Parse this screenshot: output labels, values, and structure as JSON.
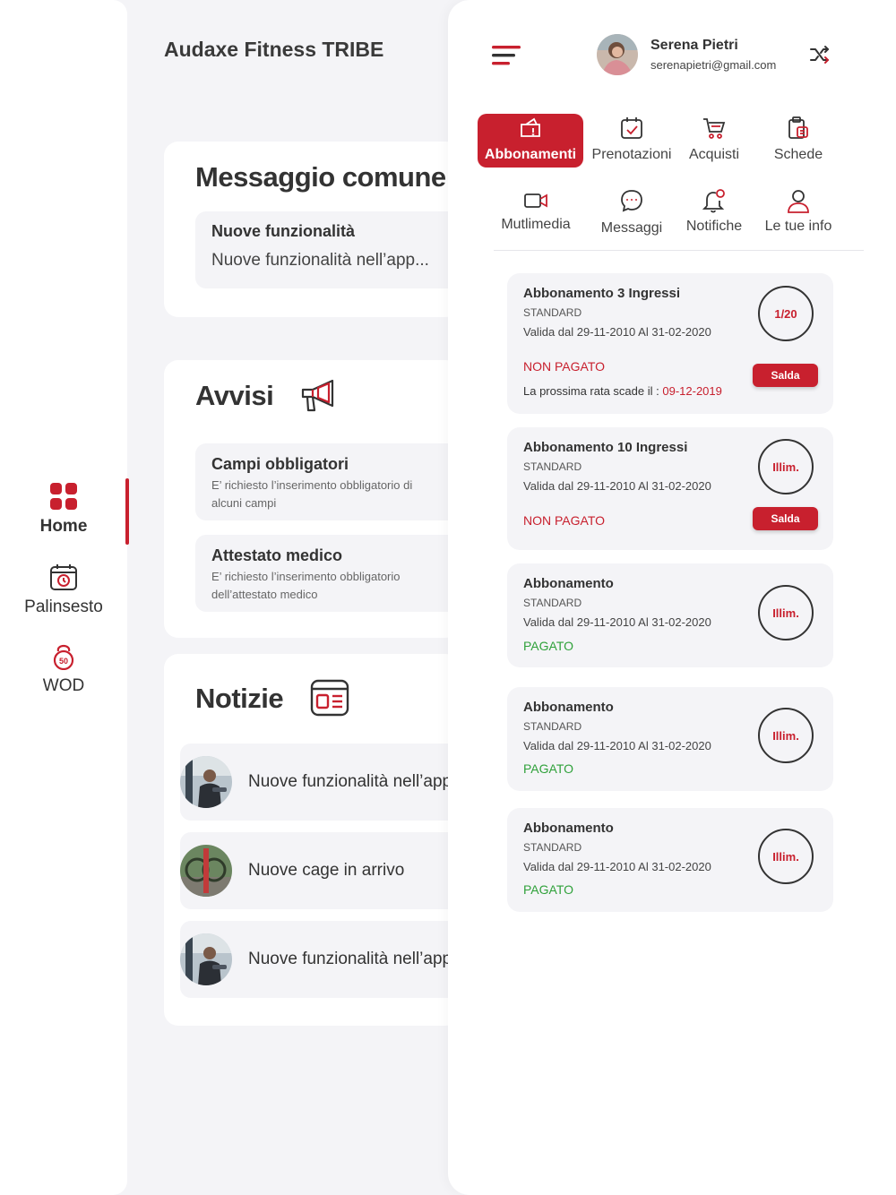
{
  "app_title": "Audaxe Fitness TRIBE",
  "nav": [
    {
      "label": "Home",
      "active": true
    },
    {
      "label": "Palinsesto",
      "active": false
    },
    {
      "label": "WOD",
      "active": false
    }
  ],
  "wod_badge": "50",
  "messaggio": {
    "title": "Messaggio comune",
    "item_title": "Nuove funzionalità",
    "item_text": "Nuove funzionalità nell’app..."
  },
  "avvisi": {
    "title": "Avvisi",
    "items": [
      {
        "title": "Campi obbligatori",
        "text": "E’ richiesto l’inserimento obbligatorio di alcuni campi"
      },
      {
        "title": "Attestato medico",
        "text": "E’ richiesto l’inserimento obbligatorio dell’attestato medico"
      }
    ]
  },
  "notizie": {
    "title": "Notizie",
    "items": [
      {
        "text": "Nuove funzionalità nell’app"
      },
      {
        "text": "Nuove cage in arrivo"
      },
      {
        "text": "Nuove funzionalità nell’app"
      }
    ]
  },
  "user": {
    "name": "Serena Pietri",
    "email": "serenapietri@gmail.com"
  },
  "tabs": [
    {
      "label": "Abbonamenti",
      "icon": "ticket-icon",
      "active": true
    },
    {
      "label": "Prenotazioni",
      "icon": "calendar-check-icon",
      "active": false
    },
    {
      "label": "Acquisti",
      "icon": "cart-icon",
      "active": false
    },
    {
      "label": "Schede",
      "icon": "clipboard-icon",
      "active": false
    },
    {
      "label": "Mutlimedia",
      "icon": "video-icon",
      "active": false
    },
    {
      "label": "Messaggi",
      "icon": "chat-icon",
      "active": false
    },
    {
      "label": "Notifiche",
      "icon": "bell-icon",
      "active": false
    },
    {
      "label": "Le tue info",
      "icon": "user-icon",
      "active": false
    }
  ],
  "subscriptions": [
    {
      "title": "Abbonamento 3 Ingressi",
      "type": "STANDARD",
      "validity": "Valida dal 29-11-2010 Al 31-02-2020",
      "status": "NON PAGATO",
      "paid": false,
      "badge": "1/20",
      "next_label": "La prossima rata scade il : ",
      "next_date": "09-12-2019",
      "button": "Salda"
    },
    {
      "title": "Abbonamento 10 Ingressi",
      "type": "STANDARD",
      "validity": "Valida dal 29-11-2010 Al 31-02-2020",
      "status": "NON PAGATO",
      "paid": false,
      "badge": "Illim.",
      "button": "Salda"
    },
    {
      "title": "Abbonamento",
      "type": "STANDARD",
      "validity": "Valida dal 29-11-2010 Al 31-02-2020",
      "status": "PAGATO",
      "paid": true,
      "badge": "Illim."
    },
    {
      "title": "Abbonamento",
      "type": "STANDARD",
      "validity": "Valida dal 29-11-2010 Al 31-02-2020",
      "status": "PAGATO",
      "paid": true,
      "badge": "Illim."
    },
    {
      "title": "Abbonamento",
      "type": "STANDARD",
      "validity": "Valida dal 29-11-2010 Al 31-02-2020",
      "status": "PAGATO",
      "paid": true,
      "badge": "Illim."
    }
  ],
  "colors": {
    "accent": "#c8202e",
    "paid": "#2fa13a",
    "background": "#f4f4f7"
  }
}
